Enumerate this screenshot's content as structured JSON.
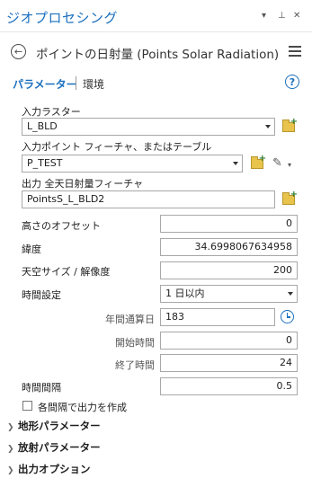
{
  "window": {
    "title": "ジオプロセシング",
    "controls": [
      "▾",
      "ᐧ₽",
      "✕"
    ]
  },
  "header": {
    "tool_title": "ポイントの日射量 (Points Solar Radiation)"
  },
  "tabs": {
    "parameters": "パラメーター",
    "environments": "環境",
    "help": "?"
  },
  "params": {
    "input_raster": {
      "label": "入力ラスター",
      "value": "L_BLD"
    },
    "input_points": {
      "label": "入力ポイント フィーチャ、またはテーブル",
      "value": "P_TEST"
    },
    "output": {
      "label": "出力 全天日射量フィーチャ",
      "value": "PointsS_L_BLD2"
    },
    "height_offset": {
      "label": "高さのオフセット",
      "value": "0"
    },
    "latitude": {
      "label": "緯度",
      "value": "34.6998067634958"
    },
    "sky_size": {
      "label": "天空サイズ / 解像度",
      "value": "200"
    },
    "time_config": {
      "label": "時間設定",
      "value": "1 日以内"
    },
    "day_of_year": {
      "label": "年間通算日",
      "value": "183"
    },
    "start_time": {
      "label": "開始時間",
      "value": "0"
    },
    "end_time": {
      "label": "終了時間",
      "value": "24"
    },
    "hour_interval": {
      "label": "時間間隔",
      "value": "0.5"
    },
    "each_interval": {
      "label": "各間隔で出力を作成",
      "checked": false
    }
  },
  "sections": [
    {
      "label": "地形パラメーター"
    },
    {
      "label": "放射パラメーター"
    },
    {
      "label": "出力オプション"
    }
  ],
  "colors": {
    "accent": "#1a6fbf",
    "folder": "#e8c44d"
  }
}
